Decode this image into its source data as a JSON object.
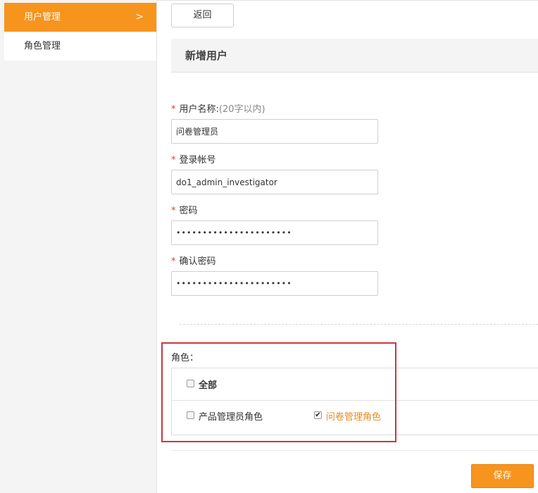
{
  "sidebar": {
    "items": [
      {
        "label": "用户管理",
        "active": true
      },
      {
        "label": "角色管理",
        "active": false
      }
    ],
    "active_chevron": ">"
  },
  "header": {
    "back_label": "返回",
    "title": "新增用户"
  },
  "form": {
    "required_mark": "*",
    "username": {
      "label": "用户名称:",
      "hint": "(20字以内)",
      "value": "问卷管理员"
    },
    "account": {
      "label": "登录帐号",
      "value": "do1_admin_investigator"
    },
    "password": {
      "label": "密码",
      "value": "••••••••••••••••••••••"
    },
    "confirm_password": {
      "label": "确认密码",
      "value": "••••••••••••••••••••••"
    }
  },
  "roles": {
    "label": "角色：",
    "all": {
      "label": "全部",
      "checked": false
    },
    "options": [
      {
        "label": "产品管理员角色",
        "checked": false
      },
      {
        "label": "问卷管理角色",
        "checked": true
      }
    ]
  },
  "footer": {
    "save_label": "保存"
  },
  "colors": {
    "accent": "#f7941d",
    "required": "#e4393c",
    "highlight_box": "#c9373c",
    "checked_text": "#e88a1a"
  }
}
